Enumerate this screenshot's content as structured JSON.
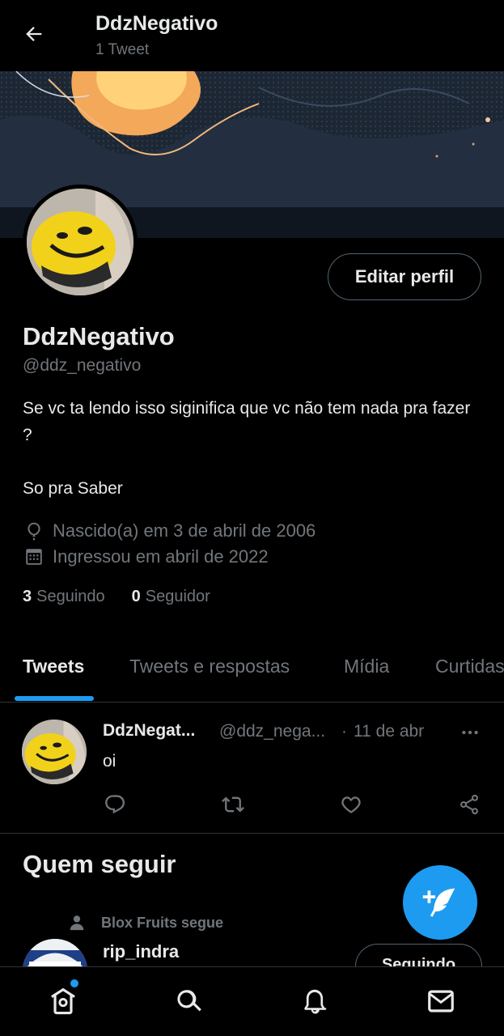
{
  "header": {
    "title": "DdzNegativo",
    "subtitle": "1 Tweet",
    "back_icon": "arrow-left-icon"
  },
  "profile": {
    "edit_button": "Editar perfil",
    "display_name": "DdzNegativo",
    "handle": "@ddz_negativo",
    "bio": "Se vc ta lendo isso siginifica que vc não tem nada pra fazer ?\n\nSo pra Saber",
    "born": "Nascido(a) em 3 de abril de 2006",
    "joined": "Ingressou em abril de 2022",
    "following_count": "3",
    "following_label": "Seguindo",
    "followers_count": "0",
    "followers_label": "Seguidor"
  },
  "tabs": [
    {
      "label": "Tweets",
      "active": true
    },
    {
      "label": "Tweets e respostas",
      "active": false
    },
    {
      "label": "Mídia",
      "active": false
    },
    {
      "label": "Curtidas",
      "active": false
    }
  ],
  "tweet": {
    "name": "DdzNegat...",
    "handle": "@ddz_nega...",
    "separator": "·",
    "date": "11 de abr",
    "text": "oi"
  },
  "who_to_follow": {
    "title": "Quem seguir",
    "context": "Blox Fruits segue",
    "user": "rip_indra",
    "button": "Seguindo"
  },
  "bottom_nav": [
    "home-icon",
    "search-icon",
    "notifications-icon",
    "messages-icon"
  ],
  "colors": {
    "accent": "#1d9bf0",
    "background": "#000000",
    "text_primary": "#e7e9ea",
    "text_secondary": "#71767b"
  }
}
